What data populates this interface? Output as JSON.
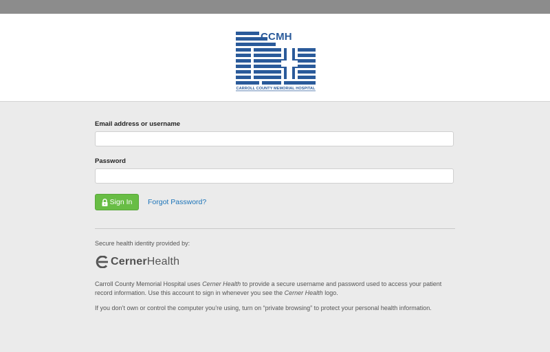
{
  "header": {
    "logo": {
      "abbr": "CCMH",
      "caption": "CARROLL COUNTY MEMORIAL HOSPITAL",
      "color": "#2a5a9a"
    }
  },
  "form": {
    "email_label": "Email address or username",
    "email_value": "",
    "password_label": "Password",
    "password_value": "",
    "sign_in_label": "Sign In",
    "forgot_label": "Forgot Password?"
  },
  "footer": {
    "secure_text": "Secure health identity provided by:",
    "cerner_bold": "Cerner",
    "cerner_light": "Health",
    "para1": {
      "a": "Carroll County Memorial Hospital uses ",
      "b": "Cerner Health",
      "c": " to provide a secure username and password used to access your patient record information. Use this account to sign in whenever you see the ",
      "d": "Cerner Health",
      "e": " logo."
    },
    "para2": "If you don’t own or control the computer you’re using, turn on “private browsing” to protect your personal health information."
  },
  "colors": {
    "accent_green": "#68bd45",
    "link_blue": "#1a73b8",
    "background": "#ebebeb"
  },
  "icons": [
    "lock-icon",
    "cerner-logo-icon",
    "ccmh-logo-icon"
  ]
}
